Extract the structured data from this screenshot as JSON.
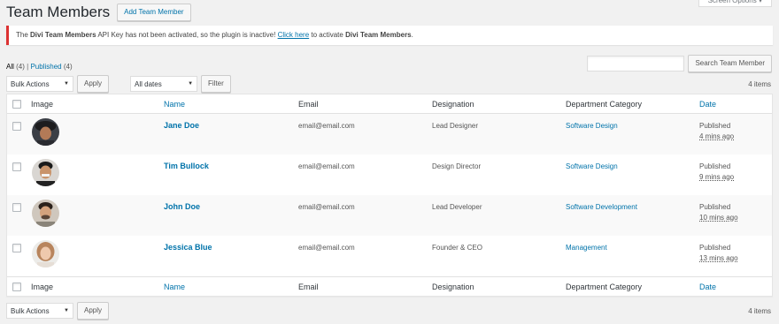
{
  "screen_options": "Screen Options ▾",
  "header": {
    "title": "Team Members",
    "add_button": "Add Team Member"
  },
  "notice": {
    "text1": "The ",
    "bold1": "Divi Team Members",
    "text2": " API Key has not been activated, so the plugin is inactive! ",
    "link": "Click here",
    "text3": " to activate ",
    "bold2": "Divi Team Members",
    "text4": "."
  },
  "views": {
    "all_label": "All",
    "all_count": "(4)",
    "separator": "|",
    "published_label": "Published",
    "published_count": "(4)"
  },
  "search": {
    "value": "",
    "button": "Search Team Member"
  },
  "tablenav_top": {
    "bulk": "Bulk Actions",
    "apply": "Apply",
    "dates": "All dates",
    "filter": "Filter",
    "items": "4 items"
  },
  "tablenav_bottom": {
    "bulk": "Bulk Actions",
    "apply": "Apply",
    "items": "4 items"
  },
  "columns": {
    "image": "Image",
    "name": "Name",
    "email": "Email",
    "designation": "Designation",
    "department": "Department Category",
    "date": "Date"
  },
  "rows": [
    {
      "name": "Jane Doe",
      "email": "email@email.com",
      "designation": "Lead Designer",
      "department": "Software Design",
      "status": "Published",
      "ago": "4 mins ago"
    },
    {
      "name": "Tim Bullock",
      "email": "email@email.com",
      "designation": "Design Director",
      "department": "Software Design",
      "status": "Published",
      "ago": "9 mins ago"
    },
    {
      "name": "John Doe",
      "email": "email@email.com",
      "designation": "Lead Developer",
      "department": "Software Development",
      "status": "Published",
      "ago": "10 mins ago"
    },
    {
      "name": "Jessica Blue",
      "email": "email@email.com",
      "designation": "Founder & CEO",
      "department": "Management",
      "status": "Published",
      "ago": "13 mins ago"
    }
  ],
  "colors": {
    "link": "#0073aa",
    "notice_border": "#dc3232",
    "background": "#f1f1f1"
  }
}
